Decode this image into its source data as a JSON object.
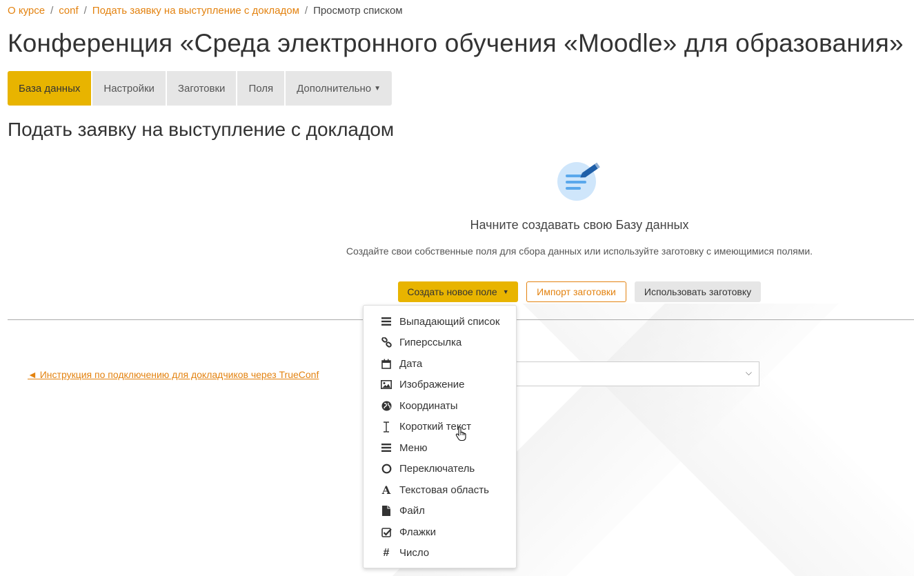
{
  "breadcrumb": {
    "items": [
      "О курсе",
      "conf",
      "Подать заявку на выступление с докладом"
    ],
    "current": "Просмотр списком"
  },
  "page_title": "Конференция «Среда электронного обучения «Moodle» для образования»",
  "tabs": [
    "База данных",
    "Настройки",
    "Заготовки",
    "Поля",
    "Дополнительно"
  ],
  "section_title": "Подать заявку на выступление с докладом",
  "empty_state": {
    "heading": "Начните создавать свою Базу данных",
    "description": "Создайте свои собственные поля для сбора данных или используйте заготовку с имеющимися полями."
  },
  "buttons": {
    "create": "Создать новое поле",
    "import": "Импорт заготовки",
    "use": "Использовать заготовку"
  },
  "prev_link": "◄ Инструкция по подключению для докладчиков через TrueConf",
  "field_types": [
    {
      "label": "Выпадающий список",
      "icon": "list-icon"
    },
    {
      "label": "Гиперссылка",
      "icon": "link-icon"
    },
    {
      "label": "Дата",
      "icon": "calendar-icon"
    },
    {
      "label": "Изображение",
      "icon": "image-icon"
    },
    {
      "label": "Координаты",
      "icon": "globe-icon"
    },
    {
      "label": "Короткий текст",
      "icon": "text-cursor-icon"
    },
    {
      "label": "Меню",
      "icon": "menu-icon"
    },
    {
      "label": "Переключатель",
      "icon": "radio-icon"
    },
    {
      "label": "Текстовая область",
      "icon": "font-icon"
    },
    {
      "label": "Файл",
      "icon": "file-icon"
    },
    {
      "label": "Флажки",
      "icon": "checkbox-icon"
    },
    {
      "label": "Число",
      "icon": "hash-icon"
    }
  ],
  "colors": {
    "accent": "#e8b400",
    "link": "#e3820f",
    "tab_bg": "#e6e6e6"
  }
}
